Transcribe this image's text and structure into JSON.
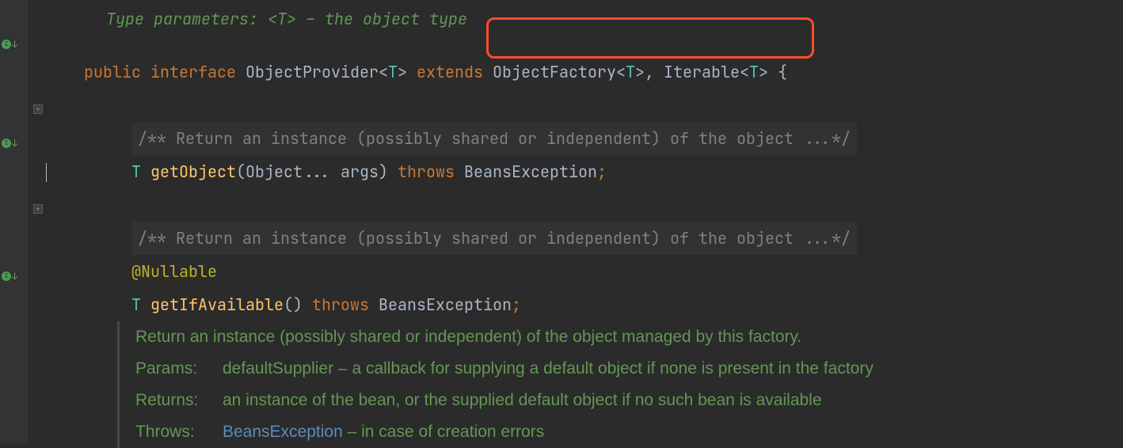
{
  "partial_comment": "Type parameters: <T> – the object type",
  "declaration": {
    "public": "public",
    "interface": "interface",
    "name": "ObjectProvider",
    "tp_open": "<",
    "tp": "T",
    "tp_close": ">",
    "extends": "extends",
    "parent1": "ObjectFactory",
    "p1_open": "<",
    "p1_tp": "T",
    "p1_close": ">",
    "comma": ",",
    "parent2": "Iterable",
    "p2_open": "<",
    "p2_tp": "T",
    "p2_close": ">",
    "brace": " {"
  },
  "method1": {
    "javadoc": "/** Return an instance (possibly shared or independent) of the object ...*/",
    "ret": "T",
    "name": "getObject",
    "paren_open": "(",
    "param_type": "Object",
    "varargs": "...",
    "param_name": "args",
    "paren_close": ")",
    "throws": "throws",
    "exc": "BeansException",
    "semi": ";"
  },
  "method2": {
    "javadoc": "/** Return an instance (possibly shared or independent) of the object ...*/",
    "annotation": "@Nullable",
    "ret": "T",
    "name": "getIfAvailable",
    "parens": "()",
    "throws": "throws",
    "exc": "BeansException",
    "semi": ";"
  },
  "doc": {
    "line1": "Return an instance (possibly shared or independent) of the object managed by this factory.",
    "params_label": "Params:",
    "params_text": "defaultSupplier – a callback for supplying a default object if none is present in the factory",
    "returns_label": "Returns:",
    "returns_text": "an instance of the bean, or the supplied default object if no such bean is available",
    "throws_label": "Throws:",
    "throws_link": "BeansException",
    "throws_text": " – in case of creation errors"
  }
}
